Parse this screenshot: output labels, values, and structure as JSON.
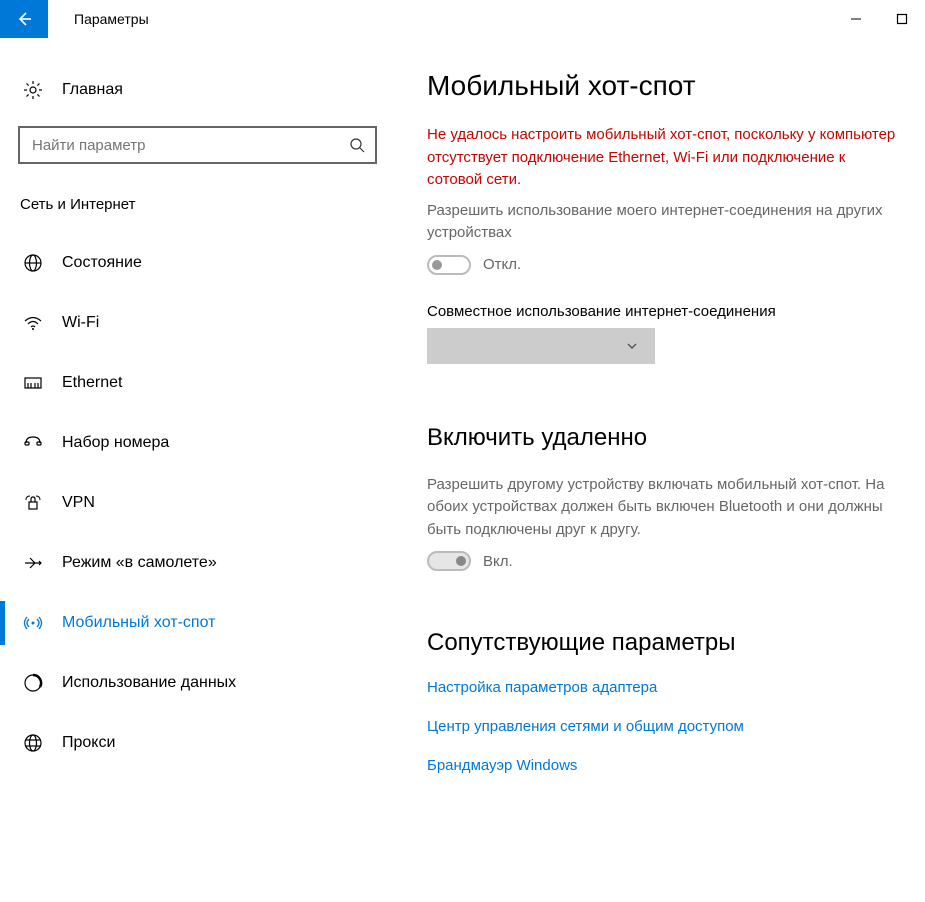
{
  "titlebar": {
    "title": "Параметры"
  },
  "sidebar": {
    "home": "Главная",
    "search_placeholder": "Найти параметр",
    "category": "Сеть и Интернет",
    "items": [
      {
        "label": "Состояние",
        "active": false
      },
      {
        "label": "Wi-Fi",
        "active": false
      },
      {
        "label": "Ethernet",
        "active": false
      },
      {
        "label": "Набор номера",
        "active": false
      },
      {
        "label": "VPN",
        "active": false
      },
      {
        "label": "Режим «в самолете»",
        "active": false
      },
      {
        "label": "Мобильный хот-спот",
        "active": true
      },
      {
        "label": "Использование данных",
        "active": false
      },
      {
        "label": "Прокси",
        "active": false
      }
    ]
  },
  "main": {
    "heading": "Мобильный хот-спот",
    "error": "Не удалось настроить мобильный хот-спот, поскольку у компьютер отсутствует подключение Ethernet, Wi-Fi или подключение к сотовой сети.",
    "share_desc": "Разрешить использование моего интернет-соединения на других устройствах",
    "share_toggle_label": "Откл.",
    "share_from_label": "Совместное использование интернет-соединения",
    "remote_heading": "Включить удаленно",
    "remote_desc": "Разрешить другому устройству включать мобильный хот-спот. На обоих устройствах должен быть включен Bluetooth и они должны быть подключены друг к другу.",
    "remote_toggle_label": "Вкл.",
    "related_heading": "Сопутствующие параметры",
    "links": [
      "Настройка параметров адаптера",
      "Центр управления сетями и общим доступом",
      "Брандмауэр Windows"
    ]
  }
}
